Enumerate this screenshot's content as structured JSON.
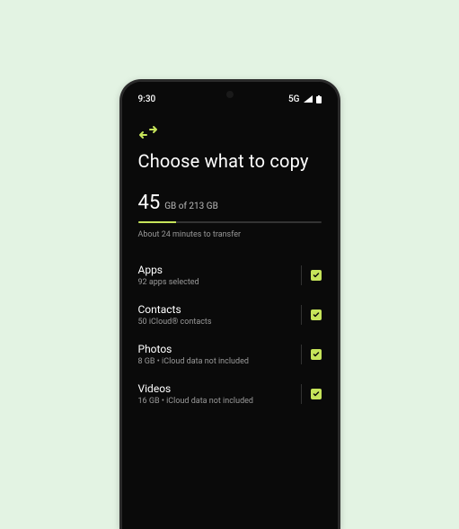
{
  "status": {
    "time": "9:30",
    "network": "5G"
  },
  "page": {
    "title": "Choose what to copy",
    "storage_used": "45",
    "storage_total": "GB of 213 GB",
    "eta": "About 24 minutes to transfer",
    "progress_pct": 21
  },
  "items": [
    {
      "label": "Apps",
      "sub": "92 apps selected",
      "checked": true
    },
    {
      "label": "Contacts",
      "sub": "50 iCloud® contacts",
      "checked": true
    },
    {
      "label": "Photos",
      "sub": "8 GB • iCloud data not included",
      "checked": true
    },
    {
      "label": "Videos",
      "sub": "16 GB • iCloud data not included",
      "checked": true
    }
  ],
  "colors": {
    "accent": "#c6e45a",
    "bg": "#0a0a0a",
    "frame_bg": "#e3f3e3"
  }
}
